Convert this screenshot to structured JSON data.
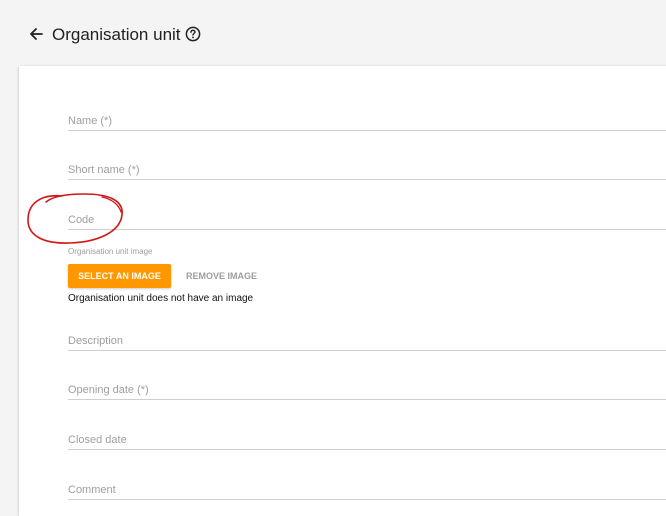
{
  "header": {
    "title": "Organisation unit",
    "back_icon": "arrow-left-icon",
    "help_icon": "help-circle-icon"
  },
  "form": {
    "fields": {
      "name": "Name (*)",
      "short_name": "Short name (*)",
      "code": "Code",
      "description": "Description",
      "opening_date": "Opening date (*)",
      "closed_date": "Closed date",
      "comment": "Comment"
    },
    "image": {
      "caption": "Organisation unit image",
      "select_label": "SELECT AN IMAGE",
      "remove_label": "REMOVE IMAGE",
      "status": "Organisation unit does not have an image"
    }
  },
  "colors": {
    "accent": "#ff9800",
    "annotation": "#d01818",
    "background": "#f4f4f4"
  }
}
